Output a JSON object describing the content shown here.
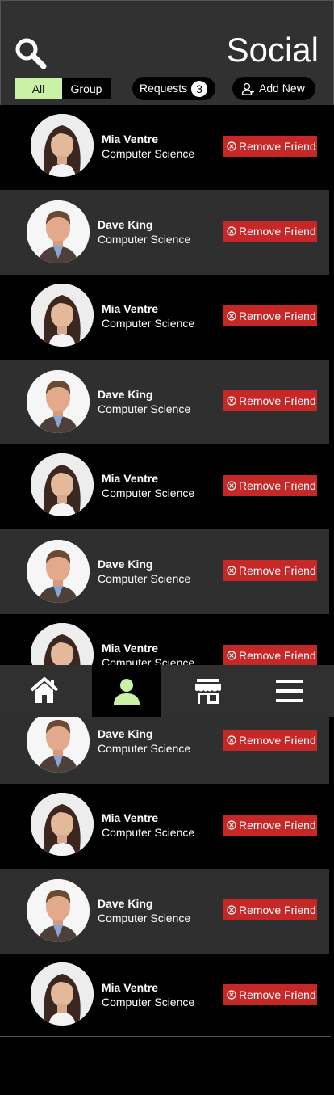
{
  "header": {
    "title": "Social",
    "filter_all": "All",
    "filter_group": "Group",
    "requests_label": "Requests",
    "requests_count": "3",
    "add_new_label": "Add New"
  },
  "colors": {
    "accent": "#c9f2a6",
    "danger": "#c62828",
    "row_alt": "#2f2f2f",
    "header_bg": "#313131"
  },
  "friends": [
    {
      "name": "Mia Ventre",
      "dept": "Computer Science",
      "action": "Remove Friend"
    },
    {
      "name": "Dave King",
      "dept": "Computer Science",
      "action": "Remove Friend"
    },
    {
      "name": "Mia Ventre",
      "dept": "Computer Science",
      "action": "Remove Friend"
    },
    {
      "name": "Dave King",
      "dept": "Computer Science",
      "action": "Remove Friend"
    },
    {
      "name": "Mia Ventre",
      "dept": "Computer Science",
      "action": "Remove Friend"
    },
    {
      "name": "Dave King",
      "dept": "Computer Science",
      "action": "Remove Friend"
    },
    {
      "name": "Mia Ventre",
      "dept": "Computer Science",
      "action": "Remove Friend"
    },
    {
      "name": "Dave King",
      "dept": "Computer Science",
      "action": "Remove Friend"
    },
    {
      "name": "Mia Ventre",
      "dept": "Computer Science",
      "action": "Remove Friend"
    },
    {
      "name": "Dave King",
      "dept": "Computer Science",
      "action": "Remove Friend"
    },
    {
      "name": "Mia Ventre",
      "dept": "Computer Science",
      "action": "Remove Friend"
    }
  ],
  "nav": [
    {
      "icon": "home-icon"
    },
    {
      "icon": "person-icon",
      "active": true
    },
    {
      "icon": "store-icon"
    },
    {
      "icon": "menu-icon"
    }
  ]
}
